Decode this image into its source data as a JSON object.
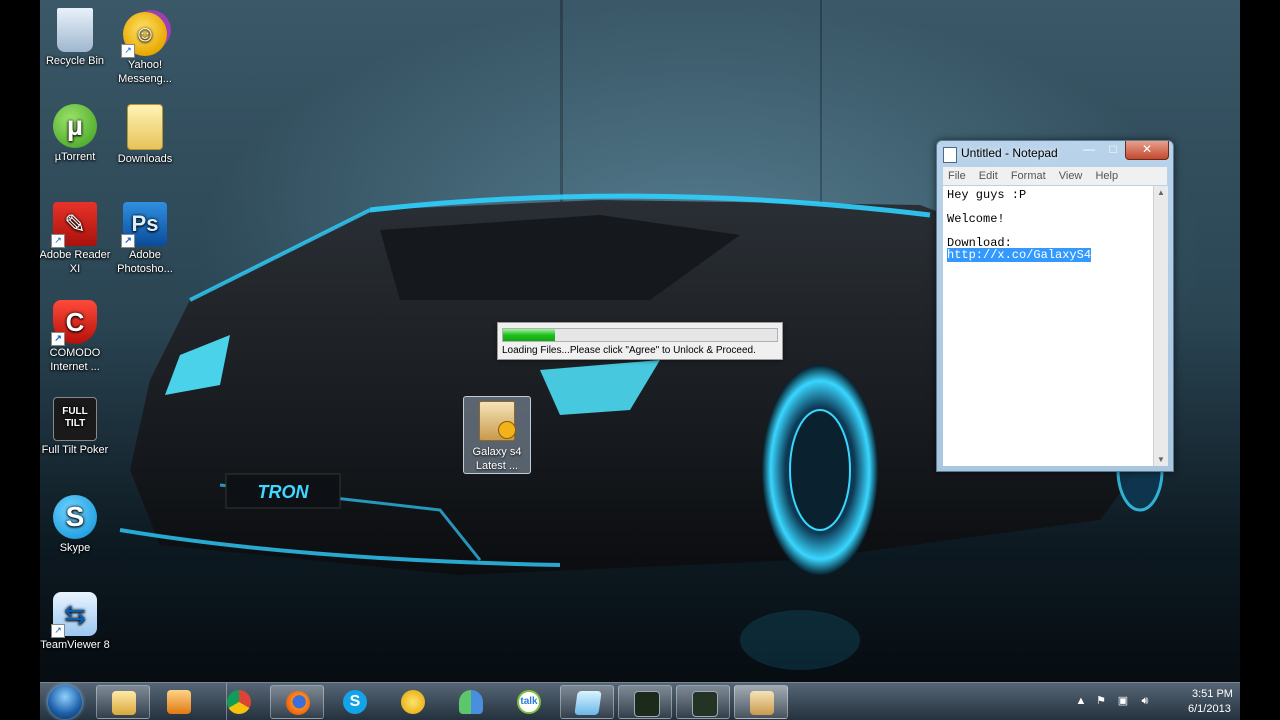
{
  "desktop": {
    "icons": [
      {
        "label": "Recycle Bin",
        "icon": "recycle-bin-icon"
      },
      {
        "label": "Yahoo! Messeng...",
        "icon": "yahoo-messenger-icon"
      },
      {
        "label": "µTorrent",
        "icon": "utorrent-icon"
      },
      {
        "label": "Downloads",
        "icon": "folder-icon"
      },
      {
        "label": "Adobe Reader XI",
        "icon": "adobe-reader-icon"
      },
      {
        "label": "Adobe Photosho...",
        "icon": "photoshop-icon"
      },
      {
        "label": "COMODO Internet ...",
        "icon": "comodo-icon"
      },
      {
        "label": "Full Tilt Poker",
        "icon": "full-tilt-poker-icon"
      },
      {
        "label": "Skype",
        "icon": "skype-icon"
      },
      {
        "label": "TeamViewer 8",
        "icon": "teamviewer-icon"
      },
      {
        "label": "Galaxy s4 Latest ...",
        "icon": "installer-package-icon"
      }
    ],
    "icon_glyphs": {
      "photoshop": "Ps",
      "full_tilt": "FULL TILT"
    },
    "car_badge": "TRON"
  },
  "notepad": {
    "title": "Untitled - Notepad",
    "controls": {
      "minimize": "—",
      "maximize": "□",
      "close": "✕"
    },
    "menu": [
      "File",
      "Edit",
      "Format",
      "View",
      "Help"
    ],
    "lines": [
      "Hey guys :P",
      "",
      "Welcome!",
      "",
      "Download:"
    ],
    "selected_line": "http://x.co/GalaxyS4"
  },
  "loader": {
    "progress_percent": 19,
    "text": "Loading Files...Please click \"Agree\" to Unlock & Proceed."
  },
  "taskbar": {
    "start": "start-orb-icon",
    "items": [
      {
        "icon": "windows-explorer-icon",
        "pinned": true
      },
      {
        "icon": "media-player-icon",
        "pinned": false
      },
      {
        "icon": "chrome-icon",
        "pinned": false
      },
      {
        "icon": "firefox-icon",
        "pinned": true
      },
      {
        "icon": "skype-icon",
        "pinned": false
      },
      {
        "icon": "yahoo-messenger-icon",
        "pinned": false
      },
      {
        "icon": "contacts-icon",
        "pinned": false
      },
      {
        "icon": "google-talk-icon",
        "pinned": false
      },
      {
        "icon": "notepad-icon",
        "pinned": true
      },
      {
        "icon": "terminal-icon",
        "pinned": true
      },
      {
        "icon": "game-icon",
        "pinned": true
      },
      {
        "icon": "installer-icon",
        "pinned": true
      }
    ],
    "tray": {
      "clock_time": "3:51 PM",
      "clock_date": "6/1/2013",
      "talk_label": "talk"
    }
  },
  "colors": {
    "accent": "#00bfff",
    "progress": "#1fbf1f"
  }
}
